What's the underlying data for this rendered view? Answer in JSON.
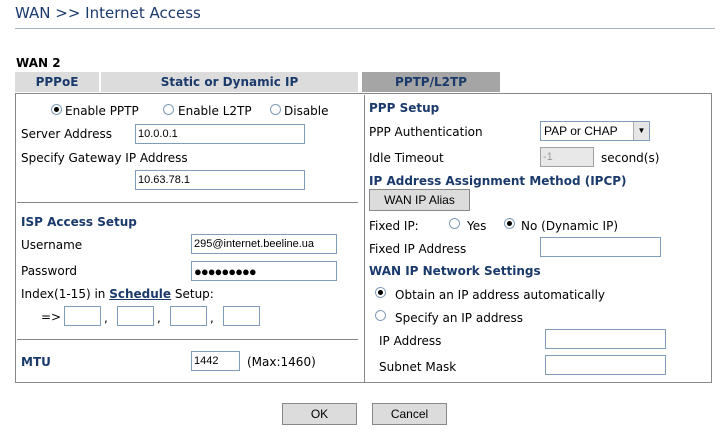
{
  "header": {
    "title": "WAN >> Internet Access"
  },
  "section_label": "WAN 2",
  "tabs": [
    {
      "label": "PPPoE",
      "active": false
    },
    {
      "label": "Static or Dynamic IP",
      "active": false
    },
    {
      "label": "PPTP/L2TP",
      "active": true
    }
  ],
  "left": {
    "mode_options": [
      {
        "label": "Enable PPTP",
        "selected": true
      },
      {
        "label": "Enable L2TP",
        "selected": false
      },
      {
        "label": "Disable",
        "selected": false
      }
    ],
    "server_address_label": "Server Address",
    "server_address_value": "10.0.0.1",
    "gateway_label": "Specify Gateway IP Address",
    "gateway_value": "10.63.78.1",
    "isp_heading": "ISP Access Setup",
    "username_label": "Username",
    "username_value": "295@internet.beeline.ua",
    "password_label": "Password",
    "password_value": "●●●●●●●●●",
    "index_prefix": "Index(1-15) in",
    "schedule_link": "Schedule",
    "index_suffix": "Setup:",
    "arrow": "=>",
    "comma": ",",
    "mtu_label": "MTU",
    "mtu_value": "1442",
    "mtu_max": "(Max:1460)"
  },
  "right": {
    "ppp_heading": "PPP Setup",
    "auth_label": "PPP Authentication",
    "auth_value": "PAP or CHAP",
    "idle_label": "Idle Timeout",
    "idle_value": "-1",
    "idle_unit": "second(s)",
    "ipcp_heading": "IP Address Assignment Method (IPCP)",
    "alias_button": "WAN IP Alias",
    "fixed_ip_label": "Fixed IP:",
    "fixed_yes": "Yes",
    "fixed_no": "No (Dynamic IP)",
    "fixed_ip_selected": "no",
    "fixed_address_label": "Fixed IP Address",
    "wan_net_heading": "WAN IP Network Settings",
    "obtain_auto": "Obtain an IP address automatically",
    "specify_ip": "Specify an IP address",
    "ip_mode_selected": "auto",
    "ip_address_label": "IP Address",
    "subnet_mask_label": "Subnet Mask"
  },
  "footer": {
    "ok_label": "OK",
    "cancel_label": "Cancel"
  }
}
